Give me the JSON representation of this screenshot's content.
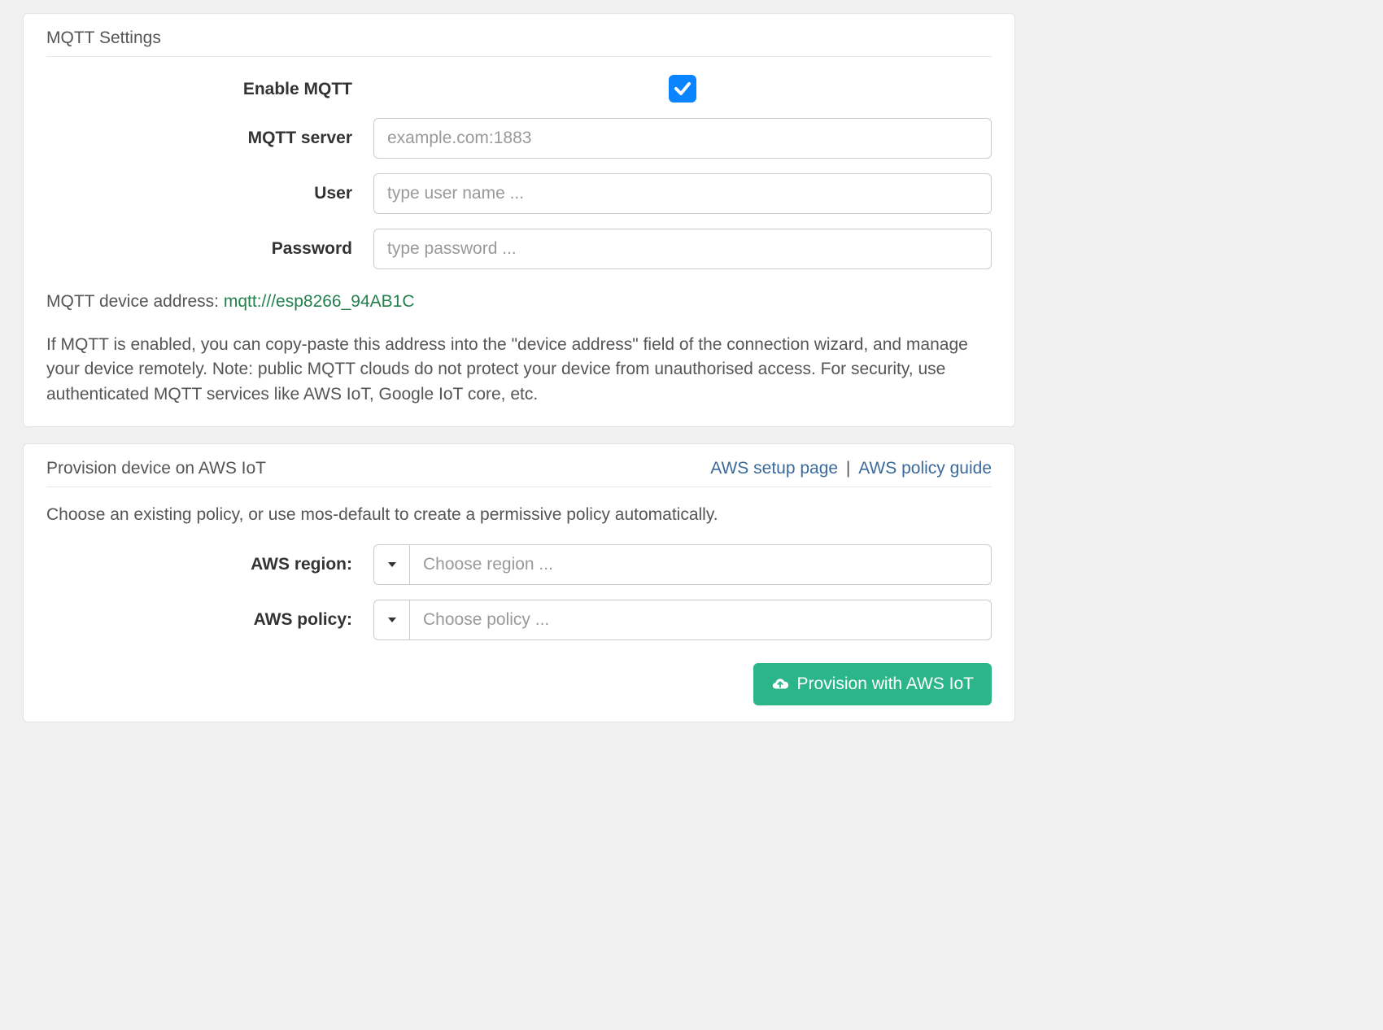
{
  "mqtt": {
    "panel_title": "MQTT Settings",
    "enable_label": "Enable MQTT",
    "enable_checked": true,
    "server_label": "MQTT server",
    "server_placeholder": "example.com:1883",
    "server_value": "",
    "user_label": "User",
    "user_placeholder": "type user name ...",
    "user_value": "",
    "password_label": "Password",
    "password_placeholder": "type password ...",
    "password_value": "",
    "device_address_prefix": "MQTT device address: ",
    "device_address_url": "mqtt:///esp8266_94AB1C",
    "help_text": "If MQTT is enabled, you can copy-paste this address into the \"device address\" field of the connection wizard, and manage your device remotely. Note: public MQTT clouds do not protect your device from unauthorised access. For security, use authenticated MQTT services like AWS IoT, Google IoT core, etc."
  },
  "aws": {
    "panel_title": "Provision device on AWS IoT",
    "link_setup": "AWS setup page",
    "link_policy": "AWS policy guide",
    "policy_hint": "Choose an existing policy, or use mos-default to create a permissive policy automatically.",
    "region_label": "AWS region:",
    "region_placeholder": "Choose region ...",
    "region_value": "",
    "policy_label": "AWS policy:",
    "policy_placeholder": "Choose policy ...",
    "policy_value": "",
    "provision_button": "Provision with AWS IoT"
  }
}
